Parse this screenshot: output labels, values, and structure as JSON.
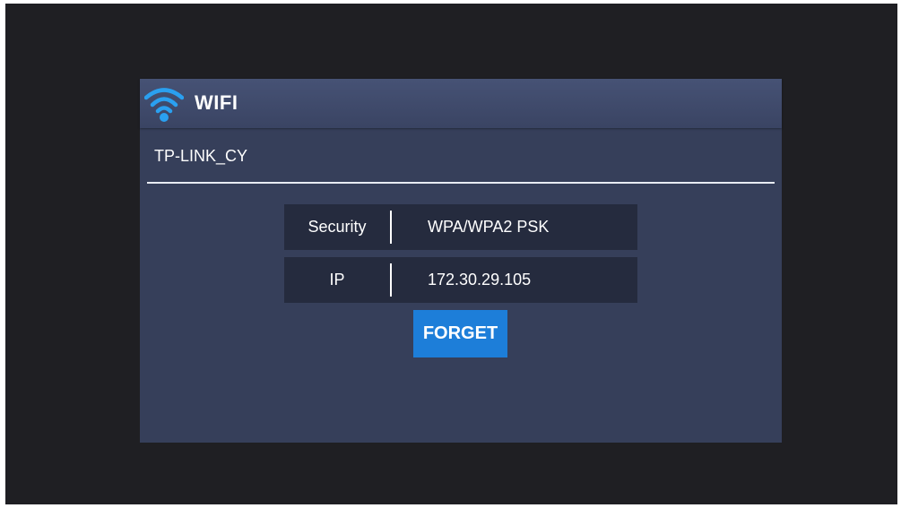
{
  "dialog": {
    "title": "WIFI",
    "icon": "wifi-icon",
    "network_name": "TP-LINK_CY",
    "details": [
      {
        "label": "Security",
        "value": "WPA/WPA2 PSK"
      },
      {
        "label": "IP",
        "value": "172.30.29.105"
      }
    ],
    "forget_label": "FORGET"
  },
  "colors": {
    "background": "#1f1f23",
    "dialog": "#363f5a",
    "header": "#465275",
    "row": "#252b3e",
    "accent": "#1d7ed9",
    "wifi_icon": "#2aa0f0"
  }
}
